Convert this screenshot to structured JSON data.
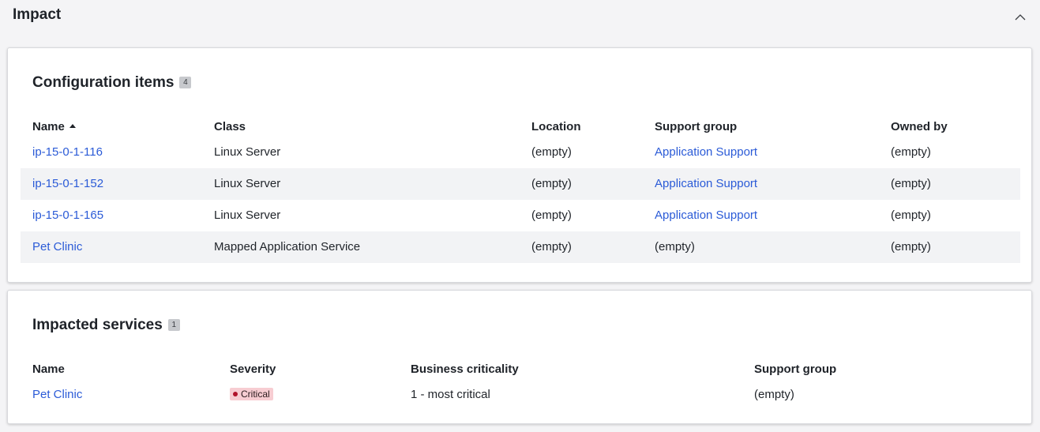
{
  "section": {
    "title": "Impact",
    "collapse_icon": "chevron-up-icon"
  },
  "configuration_items": {
    "title": "Configuration items",
    "count": "4",
    "sort_icon": "sort-ascending-icon",
    "columns": [
      "Name",
      "Class",
      "Location",
      "Support group",
      "Owned by"
    ],
    "rows": [
      {
        "name": "ip-15-0-1-116",
        "class": "Linux Server",
        "location": "(empty)",
        "support_group": "Application Support",
        "owned_by": "(empty)"
      },
      {
        "name": "ip-15-0-1-152",
        "class": "Linux Server",
        "location": "(empty)",
        "support_group": "Application Support",
        "owned_by": "(empty)"
      },
      {
        "name": "ip-15-0-1-165",
        "class": "Linux Server",
        "location": "(empty)",
        "support_group": "Application Support",
        "owned_by": "(empty)"
      },
      {
        "name": "Pet Clinic",
        "class": "Mapped Application Service",
        "location": "(empty)",
        "support_group": "(empty)",
        "owned_by": "(empty)"
      }
    ]
  },
  "impacted_services": {
    "title": "Impacted services",
    "count": "1",
    "columns": [
      "Name",
      "Severity",
      "Business criticality",
      "Support group"
    ],
    "rows": [
      {
        "name": "Pet Clinic",
        "severity": "Critical",
        "business_criticality": "1 - most critical",
        "support_group": "(empty)"
      }
    ]
  },
  "colors": {
    "link": "#2b5bd7",
    "severity_critical_bg": "#f7cdd2",
    "severity_critical_dot": "#b0122a",
    "alt_row": "#f2f3f5"
  }
}
